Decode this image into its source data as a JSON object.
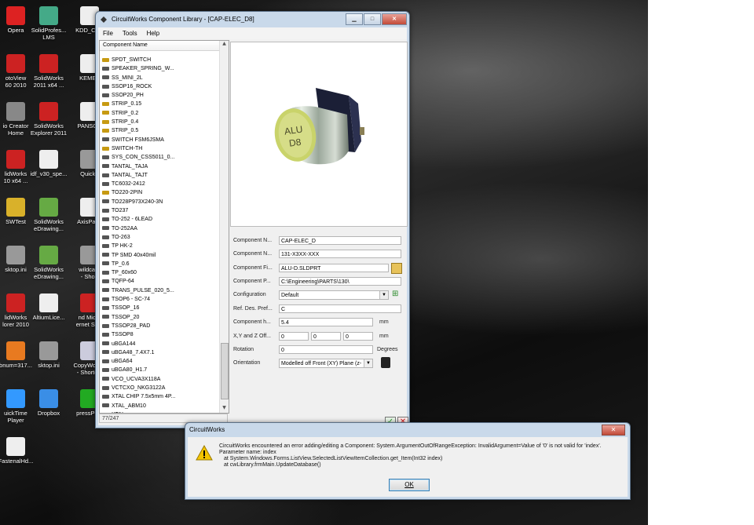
{
  "desktop_icons": [
    {
      "label": "Opera",
      "color": "#d22"
    },
    {
      "label": "SolidProfes...\nLMS",
      "color": "#4a8"
    },
    {
      "label": "KDD_Co...",
      "color": "#eee"
    },
    {
      "label": "otoView\n60 2010",
      "color": "#c22"
    },
    {
      "label": "SolidWorks\n2011 x64 ...",
      "color": "#c22"
    },
    {
      "label": "KEMET",
      "color": "#eee"
    },
    {
      "label": "io Creator\nHome",
      "color": "#888"
    },
    {
      "label": "SolidWorks\nExplorer 2011",
      "color": "#c22"
    },
    {
      "label": "PANSON",
      "color": "#eee"
    },
    {
      "label": "lidWorks\n10 x64 ...",
      "color": "#c22"
    },
    {
      "label": "idf_v30_spe...",
      "color": "#eee"
    },
    {
      "label": "QuickF",
      "color": "#999"
    },
    {
      "label": "SWTest",
      "color": "#d9b12a"
    },
    {
      "label": "SolidWorks\neDrawing...",
      "color": "#6a4"
    },
    {
      "label": "AxisParai",
      "color": "#eee"
    },
    {
      "label": "sktop.ini",
      "color": "#999"
    },
    {
      "label": "SolidWorks\neDrawing...",
      "color": "#6a4"
    },
    {
      "label": "wildcard\n- Short",
      "color": "#999"
    },
    {
      "label": "lidWorks\nlorer 2010",
      "color": "#c22"
    },
    {
      "label": "AltiumLice...",
      "color": "#eee"
    },
    {
      "label": "nd Micro\nernet Se...",
      "color": "#c22"
    },
    {
      "label": "bnum=317...",
      "color": "#e87a20"
    },
    {
      "label": "sktop.ini",
      "color": "#999"
    },
    {
      "label": "CopyWork...\n- Shortcut",
      "color": "#ccd"
    },
    {
      "label": "uickTime\nPlayer",
      "color": "#39f"
    },
    {
      "label": "Dropbox",
      "color": "#3a8ee6"
    },
    {
      "label": "pressPCB",
      "color": "#2a2"
    },
    {
      "label": "FastenalHd...",
      "color": "#eee"
    }
  ],
  "window": {
    "title": "CircuitWorks Component Library - [CAP-ELEC_D8]",
    "menu": [
      "File",
      "Tools",
      "Help"
    ],
    "list_header": "Component Name",
    "items": [
      {
        "name": "SPDT_SWITCH",
        "gold": true
      },
      {
        "name": "SPEAKER_SPRING_W...",
        "gold": false
      },
      {
        "name": "SS_MINI_2L",
        "gold": false
      },
      {
        "name": "SSOP16_ROCK",
        "gold": false
      },
      {
        "name": "SSOP20_PH",
        "gold": false
      },
      {
        "name": "STRIP_0.15",
        "gold": true
      },
      {
        "name": "STRIP_0.2",
        "gold": true
      },
      {
        "name": "STRIP_0.4",
        "gold": true
      },
      {
        "name": "STRIP_0.5",
        "gold": true
      },
      {
        "name": "SWITCH FSM6JSMA",
        "gold": false
      },
      {
        "name": "SWITCH-TH",
        "gold": true
      },
      {
        "name": "SYS_CON_CSS5011_0...",
        "gold": false
      },
      {
        "name": "TANTAL_TAJA",
        "gold": false
      },
      {
        "name": "TANTAL_TAJT",
        "gold": false
      },
      {
        "name": "TC6032-2412",
        "gold": false
      },
      {
        "name": "TO220-2PIN",
        "gold": true
      },
      {
        "name": "TO228P973X240-3N",
        "gold": false
      },
      {
        "name": "TO237",
        "gold": false
      },
      {
        "name": "TO-252 - 6LEAD",
        "gold": false
      },
      {
        "name": "TO-252AA",
        "gold": false
      },
      {
        "name": "TO-263",
        "gold": false
      },
      {
        "name": "TP HK-2",
        "gold": false
      },
      {
        "name": "TP SMD 40x40mil",
        "gold": false
      },
      {
        "name": "TP_0.6",
        "gold": false
      },
      {
        "name": "TP_60x60",
        "gold": false
      },
      {
        "name": "TQFP-64",
        "gold": false
      },
      {
        "name": "TRANS_PULSE_020_5...",
        "gold": false
      },
      {
        "name": "TSOP6 - SC-74",
        "gold": false
      },
      {
        "name": "TSSOP_16",
        "gold": false
      },
      {
        "name": "TSSOP_20",
        "gold": false
      },
      {
        "name": "TSSOP28_PAD",
        "gold": false
      },
      {
        "name": "TSSOP8",
        "gold": false
      },
      {
        "name": "uBGA144",
        "gold": false
      },
      {
        "name": "uBGA48_7.4X7.1",
        "gold": false
      },
      {
        "name": "uBGA64",
        "gold": false
      },
      {
        "name": "uBGA80_H1.7",
        "gold": false
      },
      {
        "name": "VCO_UCVA3X118A",
        "gold": false
      },
      {
        "name": "VCTCXO_NKG3122A",
        "gold": false
      },
      {
        "name": "XTAL CHIP 7.5x5mm 4P...",
        "gold": false
      },
      {
        "name": "XTAL_ABM10",
        "gold": false
      },
      {
        "name": "XTAL_...",
        "gold": false
      }
    ],
    "status": "77/247",
    "preview_text": "ALU\nD8",
    "props": {
      "name_label": "Component N...",
      "name_value": "CAP-ELEC_D",
      "number_label": "Component N...",
      "number_value": "131-X3XX-XXX",
      "file_label": "Component Fi...",
      "file_value": "ALU-D.SLDPRT",
      "path_label": "Component P...",
      "path_value": "C:\\Engineering\\PARTS\\130\\",
      "config_label": "Configuration",
      "config_value": "Default",
      "refdes_label": "Ref. Des. Pref...",
      "refdes_value": "C",
      "height_label": "Component h...",
      "height_value": "5.4",
      "height_unit": "mm",
      "offset_label": "X,Y and Z Off...",
      "offset_x": "0",
      "offset_y": "0",
      "offset_z": "0",
      "offset_unit": "mm",
      "rotation_label": "Rotation",
      "rotation_value": "0",
      "rotation_unit": "Degrees",
      "orientation_label": "Orientation",
      "orientation_value": "Modelled off Front (XY) Plane (z-"
    }
  },
  "dialog": {
    "title": "CircuitWorks",
    "line1": "CircuitWorks encountered an error adding/editing a Component: System.ArgumentOutOfRangeException: InvalidArgument=Value of '0' is not valid for 'index'.",
    "line2": "Parameter name: index",
    "line3": "at System.Windows.Forms.ListView.SelectedListViewItemCollection.get_Item(Int32 index)",
    "line4": "at cwLibrary.frmMain.UpdateDatabase()",
    "ok": "OK"
  },
  "colors": {
    "accent": "#3c7fb1",
    "ok": "#2c9a2c",
    "cancel": "#d02020"
  }
}
